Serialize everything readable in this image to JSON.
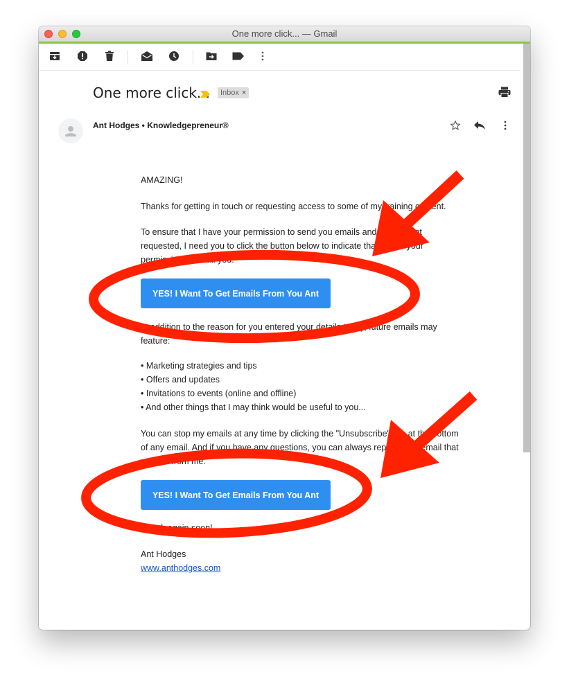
{
  "window": {
    "title": "One more click... — Gmail"
  },
  "toolbar": {
    "icons": [
      "archive-icon",
      "report-spam-icon",
      "delete-icon",
      "mark-unread-icon",
      "snooze-icon",
      "move-to-icon",
      "label-icon",
      "more-icon"
    ]
  },
  "email": {
    "subject": "One more click...",
    "label": "Inbox",
    "label_remove": "×",
    "sender": "Ant Hodges • Knowledgepreneur®",
    "greeting": "AMAZING!",
    "para1": "Thanks for getting in touch or requesting access to some of my training content.",
    "para2": "To ensure that I have your permission to send you emails and the content requested, I need you to click the button below to indicate that I have your permission to email you.",
    "button_label": "YES! I Want To Get Emails From You Ant",
    "para3": "In addition to the reason for you entered your details today, future emails may feature:",
    "bullets": [
      "• Marketing strategies and tips",
      "• Offers and updates",
      "• Invitations to events (online and offline)",
      "• And other things that I may think would be useful to you..."
    ],
    "para4": "You can stop my emails at any time by clicking the \"Unsubscribe\" link at the bottom of any email. And if you have any questions, you can always reply to any email that you get from me.",
    "button_label_2": "YES! I Want To Get Emails From You Ant",
    "signoff": "Speak again soon!",
    "signature_name": "Ant Hodges",
    "signature_link": "www.anthodges.com"
  },
  "annotations": {
    "color": "#ff2200"
  },
  "colors": {
    "button": "#2f8ff0",
    "link": "#1155cc",
    "accent_bar": "#8bc34a"
  }
}
